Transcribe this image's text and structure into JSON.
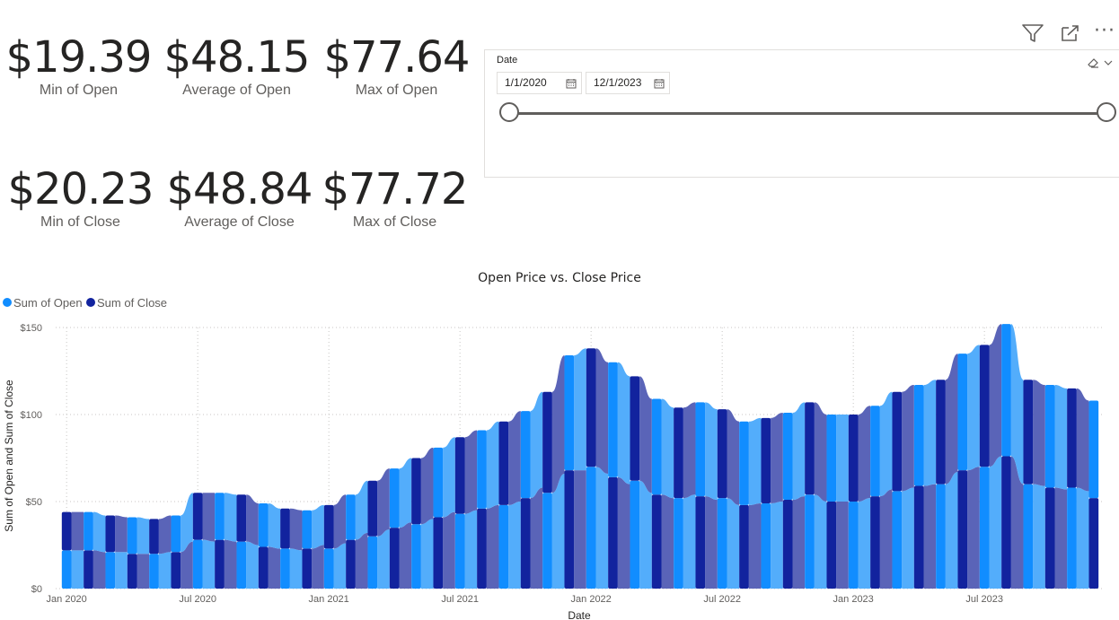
{
  "kpis": [
    {
      "value": "$19.39",
      "label": "Min of Open"
    },
    {
      "value": "$48.15",
      "label": "Average of Open"
    },
    {
      "value": "$77.64",
      "label": "Max of Open"
    },
    {
      "value": "$20.23",
      "label": "Min of Close"
    },
    {
      "value": "$48.84",
      "label": "Average of Close"
    },
    {
      "value": "$77.72",
      "label": "Max of Close"
    }
  ],
  "slicer": {
    "title": "Date",
    "start": "1/1/2020",
    "end": "12/1/2023",
    "range_fraction": [
      0,
      1
    ]
  },
  "toolbar": {
    "icons": [
      "filter-icon",
      "focus-mode-icon",
      "more-options-icon"
    ],
    "more_glyph": "···"
  },
  "colors": {
    "open": "#118dff",
    "close": "#12239e",
    "open_area": "#53adfb",
    "close_area": "#5a64b8"
  },
  "chart_data": {
    "type": "area",
    "title": "Open Price vs. Close Price",
    "xlabel": "Date",
    "ylabel": "Sum of Open and Sum of Close",
    "legend_position": "top-left",
    "grid": true,
    "ylim": [
      0,
      150
    ],
    "yticks": [
      "$0",
      "$50",
      "$100",
      "$150"
    ],
    "xticks": [
      "Jan 2020",
      "Jul 2020",
      "Jan 2021",
      "Jul 2021",
      "Jan 2022",
      "Jul 2022",
      "Jan 2023",
      "Jul 2023"
    ],
    "x": [
      "Jan 2020",
      "Feb 2020",
      "Mar 2020",
      "Apr 2020",
      "May 2020",
      "Jun 2020",
      "Jul 2020",
      "Aug 2020",
      "Sep 2020",
      "Oct 2020",
      "Nov 2020",
      "Dec 2020",
      "Jan 2021",
      "Feb 2021",
      "Mar 2021",
      "Apr 2021",
      "May 2021",
      "Jun 2021",
      "Jul 2021",
      "Aug 2021",
      "Sep 2021",
      "Oct 2021",
      "Nov 2021",
      "Dec 2021",
      "Jan 2022",
      "Feb 2022",
      "Mar 2022",
      "Apr 2022",
      "May 2022",
      "Jun 2022",
      "Jul 2022",
      "Aug 2022",
      "Sep 2022",
      "Oct 2022",
      "Nov 2022",
      "Dec 2022",
      "Jan 2023",
      "Feb 2023",
      "Mar 2023",
      "Apr 2023",
      "May 2023",
      "Jun 2023",
      "Jul 2023",
      "Aug 2023",
      "Sep 2023",
      "Oct 2023",
      "Nov 2023",
      "Dec 2023"
    ],
    "series": [
      {
        "name": "Sum of Open",
        "values": [
          22,
          22,
          21,
          21,
          20,
          21,
          28,
          27,
          27,
          25,
          23,
          22,
          23,
          26,
          30,
          34,
          37,
          40,
          43,
          45,
          48,
          50,
          55,
          66,
          70,
          66,
          62,
          55,
          52,
          54,
          52,
          48,
          49,
          50,
          54,
          50,
          50,
          52,
          56,
          58,
          60,
          67,
          70,
          76,
          60,
          59,
          58,
          56
        ]
      },
      {
        "name": "Sum of Close",
        "values": [
          22,
          22,
          21,
          20,
          20,
          21,
          27,
          28,
          27,
          24,
          23,
          23,
          25,
          28,
          32,
          35,
          38,
          41,
          44,
          46,
          48,
          52,
          58,
          68,
          68,
          64,
          60,
          54,
          52,
          53,
          51,
          48,
          49,
          51,
          53,
          50,
          50,
          53,
          57,
          59,
          60,
          68,
          70,
          76,
          60,
          58,
          57,
          52
        ]
      }
    ]
  }
}
